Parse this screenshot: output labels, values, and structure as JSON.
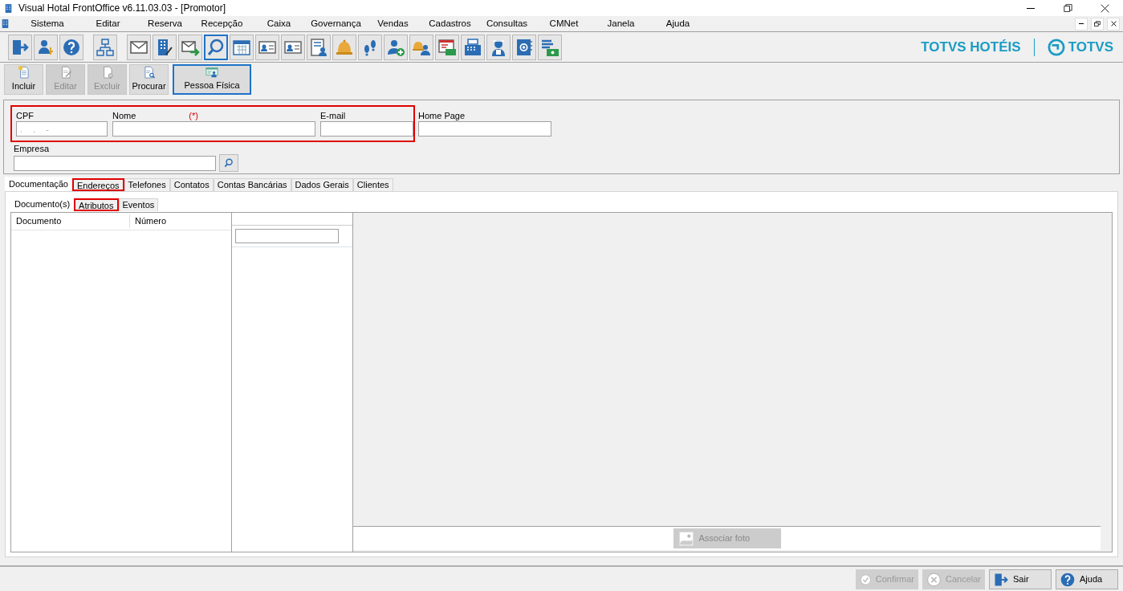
{
  "window": {
    "title": "Visual Hotal FrontOffice v6.11.03.03 - [Promotor]"
  },
  "menu": [
    "Sistema",
    "Editar",
    "Reserva",
    "Recepção",
    "Caixa",
    "Governança",
    "Vendas",
    "Cadastros",
    "Consultas",
    "CMNet",
    "Janela",
    "Ajuda"
  ],
  "toolbar": [
    {
      "kind": "exit",
      "selected": false
    },
    {
      "kind": "user-key",
      "selected": false
    },
    {
      "kind": "help",
      "selected": false
    },
    {
      "kind": "org",
      "selected": false
    },
    {
      "kind": "mail",
      "selected": false
    },
    {
      "kind": "building",
      "selected": false
    },
    {
      "kind": "mail-send",
      "selected": false
    },
    {
      "kind": "search",
      "selected": true
    },
    {
      "kind": "calendar",
      "selected": false
    },
    {
      "kind": "card",
      "selected": false
    },
    {
      "kind": "card",
      "selected": false
    },
    {
      "kind": "list-user",
      "selected": false
    },
    {
      "kind": "bell",
      "selected": false
    },
    {
      "kind": "steps",
      "selected": false
    },
    {
      "kind": "user-add",
      "selected": false
    },
    {
      "kind": "bell-user",
      "selected": false
    },
    {
      "kind": "window-money",
      "selected": false
    },
    {
      "kind": "register",
      "selected": false
    },
    {
      "kind": "maid",
      "selected": false
    },
    {
      "kind": "address-book",
      "selected": false
    },
    {
      "kind": "list-money",
      "selected": false
    }
  ],
  "brand": {
    "product": "TOTVS HOTÉIS",
    "company": "TOTVS"
  },
  "actions": [
    {
      "label": "Incluir",
      "kind": "add",
      "disabled": false,
      "selected": false
    },
    {
      "label": "Editar",
      "kind": "edit",
      "disabled": true,
      "selected": false
    },
    {
      "label": "Excluir",
      "kind": "delete",
      "disabled": true,
      "selected": false
    },
    {
      "label": "Procurar",
      "kind": "find",
      "disabled": false,
      "selected": false
    },
    {
      "label": "Pessoa Física",
      "kind": "person",
      "disabled": false,
      "selected": true
    }
  ],
  "form": {
    "fields": [
      {
        "label": "CPF",
        "value": ". . -",
        "highlighted": true
      },
      {
        "label": "Nome",
        "required_mark": "(*)",
        "highlighted": true
      },
      {
        "label": "E-mail",
        "highlighted": true
      },
      {
        "label": "Home Page",
        "highlighted": false
      }
    ],
    "company": {
      "label": "Empresa"
    }
  },
  "tabs": [
    {
      "label": "Documentação",
      "selected": true,
      "highlighted": false
    },
    {
      "label": "Endereços",
      "selected": false,
      "highlighted": true
    },
    {
      "label": "Telefones",
      "selected": false,
      "highlighted": false
    },
    {
      "label": "Contatos",
      "selected": false,
      "highlighted": false
    },
    {
      "label": "Contas Bancárias",
      "selected": false,
      "highlighted": false
    },
    {
      "label": "Dados Gerais",
      "selected": false,
      "highlighted": false
    },
    {
      "label": "Clientes",
      "selected": false,
      "highlighted": false
    }
  ],
  "subtabs": [
    {
      "label": "Documento(s)",
      "selected": true,
      "highlighted": false
    },
    {
      "label": "Atributos",
      "selected": false,
      "highlighted": true
    },
    {
      "label": "Eventos",
      "selected": false,
      "highlighted": false
    }
  ],
  "documents": {
    "columns": [
      "Documento",
      "Número"
    ]
  },
  "photo": {
    "button": {
      "label": "Associar foto",
      "disabled": true
    }
  },
  "footer": [
    {
      "label": "Confirmar",
      "kind": "confirm",
      "disabled": true
    },
    {
      "label": "Cancelar",
      "kind": "cancel",
      "disabled": true
    },
    {
      "label": "Sair",
      "kind": "exit",
      "disabled": false
    },
    {
      "label": "Ajuda",
      "kind": "help",
      "disabled": false
    }
  ]
}
